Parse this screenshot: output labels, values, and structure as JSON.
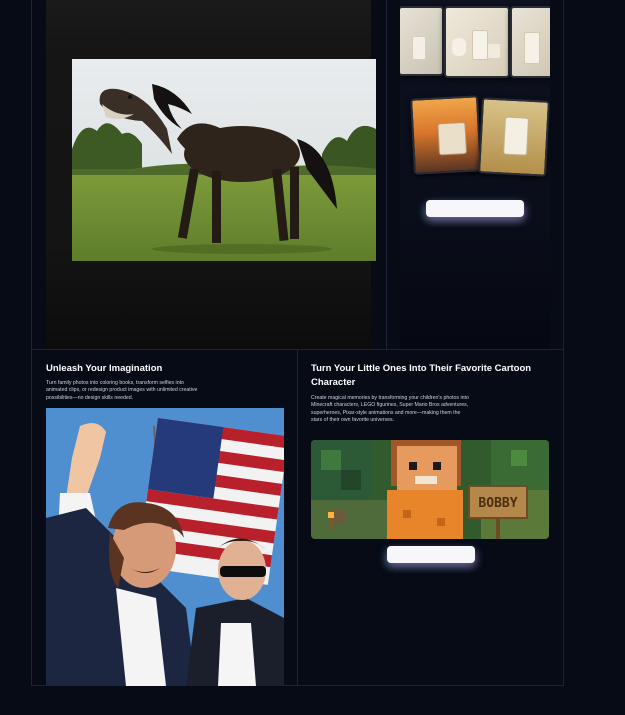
{
  "cards": {
    "horse": {
      "image_alt": "horse-with-dinosaur-head"
    },
    "products": {
      "button_label": ""
    },
    "imagination": {
      "title": "Unleash Your Imagination",
      "description": "Turn family photos into coloring books, transform selfies into animated clips, or redesign product images with unlimited creative possibilities—no design skills needed.",
      "image_alt": "rally-photo-with-flag"
    },
    "cartoon": {
      "title": "Turn Your Little Ones Into Their Favorite Cartoon Character",
      "description": "Create magical memories by transforming your children's photos into Minecraft characters, LEGO figurines, Super Mario Bros adventures, superheroes, Pixar-style animations and more—making them the stars of their own favorite universes.",
      "sign_text": "BOBBY",
      "button_label": ""
    }
  },
  "colors": {
    "background": "#070b16",
    "border": "#1c2335",
    "button": "#f6f6fb"
  }
}
